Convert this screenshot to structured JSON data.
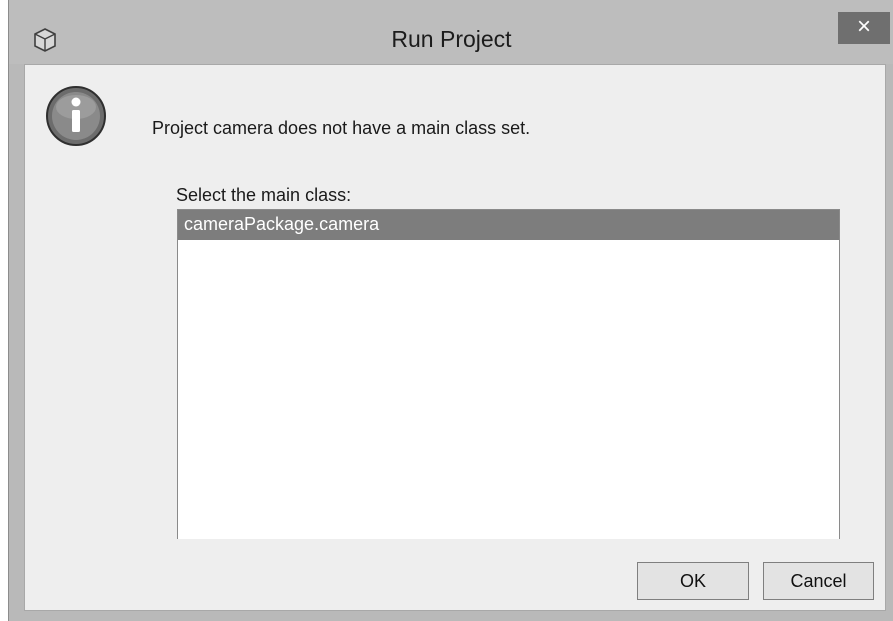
{
  "window": {
    "title": "Run Project",
    "close_label": "×"
  },
  "dialog": {
    "message": "Project camera does not have a main class set.",
    "list_label": "Select the main class:",
    "classes": [
      "cameraPackage.camera"
    ],
    "selected_index": 0
  },
  "buttons": {
    "ok_label": "OK",
    "cancel_label": "Cancel"
  },
  "icons": {
    "app": "cube-icon",
    "info": "info-icon",
    "close": "close-icon"
  }
}
